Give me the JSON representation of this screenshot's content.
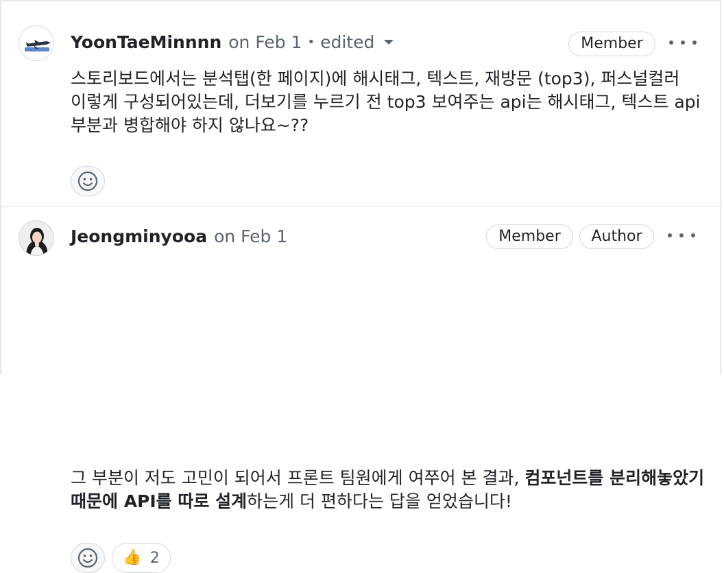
{
  "comments": [
    {
      "author": "YoonTaeMinnnn",
      "date": "on Feb 1",
      "separator": "•",
      "edited": "edited",
      "badges": [
        "Member"
      ],
      "body_plain": "스토리보드에서는 분석탭(한 페이지)에 해시태그, 텍스트, 재방문 (top3), 퍼스널컬러 이렇게 구성되어있는데, 더보기를 누르기 전 top3 보여주는 api는 해시태그, 텍스트 api 부분과 병합해야 하지 않나요~??",
      "reactions": []
    },
    {
      "author": "Jeongminyooa",
      "date": "on Feb 1",
      "badges": [
        "Member",
        "Author"
      ],
      "body_parts": [
        {
          "text": "그 부분이 저도 고민이 되어서 프론트 팀원에게 여쭈어 본 결과, ",
          "bold": false
        },
        {
          "text": "컴포넌트를 분리해놓았기 때문에 API를 따로 설계",
          "bold": true
        },
        {
          "text": "하는게 더 편하다는 답을 얻었습니다!",
          "bold": false
        }
      ],
      "reactions": [
        {
          "emoji": "👍",
          "count": "2"
        }
      ]
    }
  ],
  "icons": {
    "more": "kebab-horizontal-icon",
    "add_reaction": "smiley-icon",
    "thumbs_up": "thumbs-up-emoji",
    "dropdown": "triangle-down-icon"
  },
  "colors": {
    "text": "#1f2328",
    "muted": "#59636e",
    "border": "#d0d7de"
  }
}
